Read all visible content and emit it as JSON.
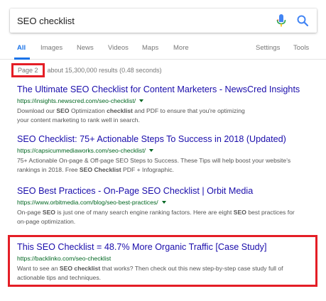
{
  "search": {
    "query": "SEO checklist"
  },
  "tabs": {
    "all": "All",
    "images": "Images",
    "news": "News",
    "videos": "Videos",
    "maps": "Maps",
    "more": "More",
    "settings": "Settings",
    "tools": "Tools"
  },
  "stats": {
    "page": "Page 2",
    "text": "about 15,300,000 results (0.48 seconds)"
  },
  "results": [
    {
      "title": "The Ultimate SEO Checklist for Content Marketers - NewsCred Insights",
      "url": "https://insights.newscred.com/seo-checklist/",
      "snippet_1a": "Download our ",
      "snippet_1b": "SEO",
      "snippet_1c": " Optimization ",
      "snippet_1d": "checklist",
      "snippet_1e": " and PDF to ensure that you're optimizing",
      "snippet_2": "your content marketing to rank well in search."
    },
    {
      "title": "SEO Checklist: 75+ Actionable Steps To Success in 2018 (Updated)",
      "url": "https://capsicummediaworks.com/seo-checklist/",
      "snippet_1": "75+ Actionable On-page & Off-page SEO Steps to Success. These Tips will help boost your website's",
      "snippet_2a": "rankings in 2018. Free ",
      "snippet_2b": "SEO Checklist",
      "snippet_2c": " PDF + Infographic."
    },
    {
      "title": "SEO Best Practices - On-Page SEO Checklist | Orbit Media",
      "url": "https://www.orbitmedia.com/blog/seo-best-practices/",
      "snippet_1a": "On-page ",
      "snippet_1b": "SEO",
      "snippet_1c": " is just one of many search engine ranking factors. Here are eight ",
      "snippet_1d": "SEO",
      "snippet_1e": " best practices for",
      "snippet_2": "on-page optimization."
    },
    {
      "title": "This SEO Checklist = 48.7% More Organic Traffic [Case Study]",
      "url": "https://backlinko.com/seo-checklist",
      "snippet_1a": "Want to see an ",
      "snippet_1b": "SEO checklist",
      "snippet_1c": " that works? Then check out this new step-by-step case study full of",
      "snippet_2": "actionable tips and techniques."
    }
  ],
  "colors": {
    "link": "#1a0dab",
    "url": "#006621",
    "accent": "#1a73e8",
    "highlight": "#e41e26"
  },
  "icons": [
    "mic-icon",
    "search-icon",
    "dropdown-arrow-icon"
  ]
}
